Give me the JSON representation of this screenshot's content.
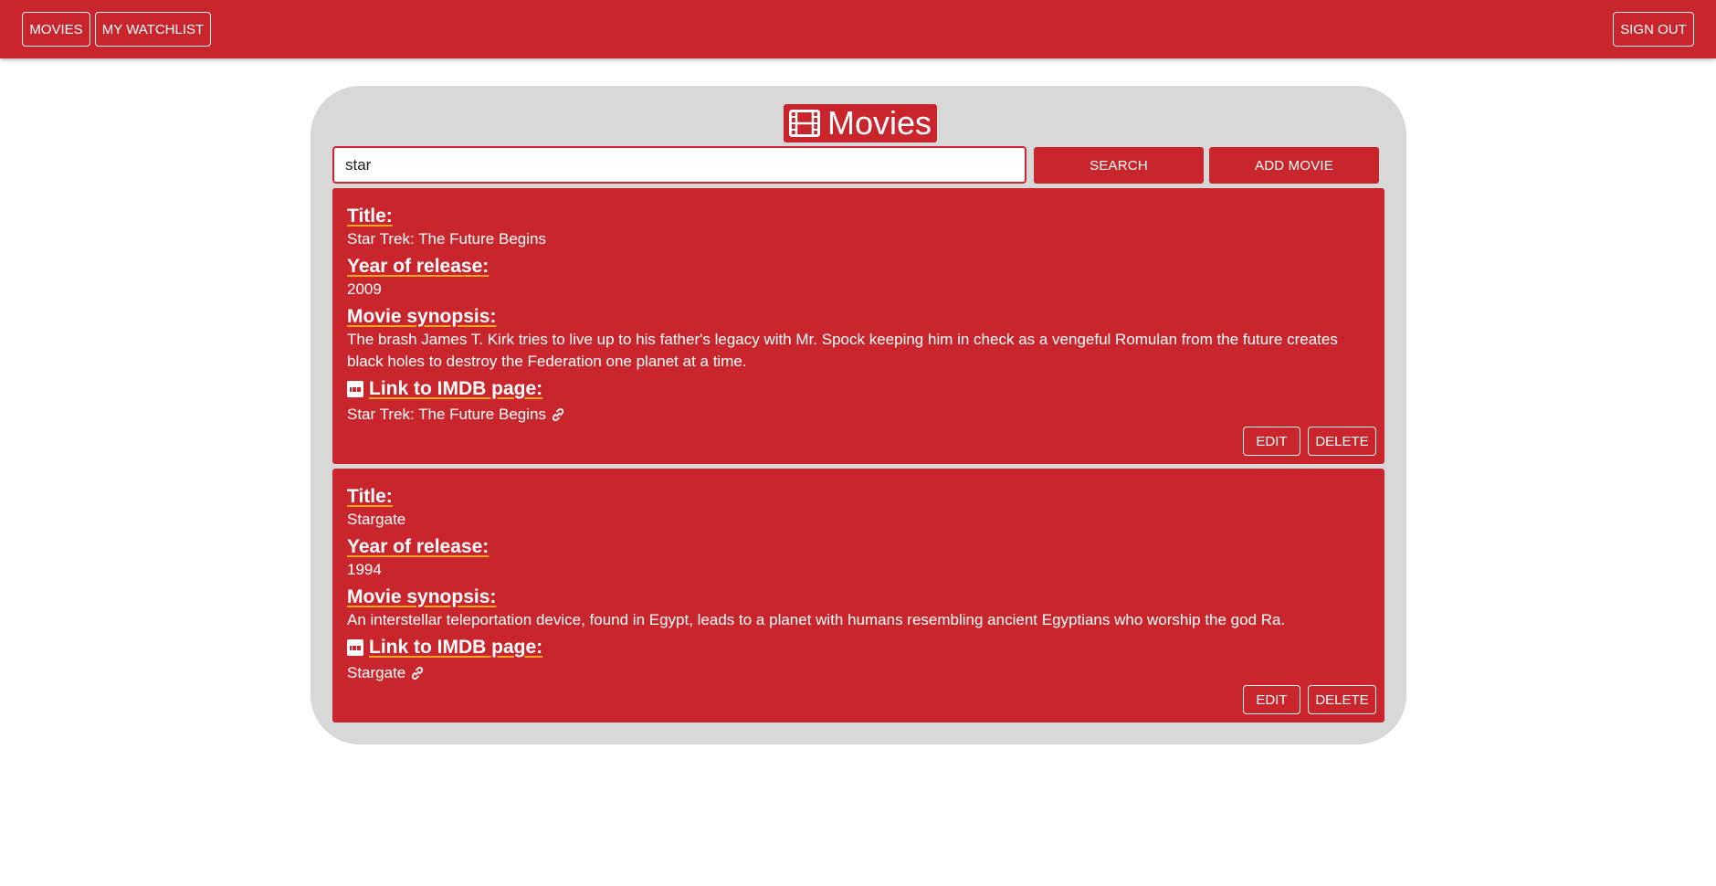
{
  "nav": {
    "movies_label": "MOVIES",
    "watchlist_label": "MY WATCHLIST",
    "signout_label": "SIGN OUT"
  },
  "page": {
    "title": "Movies",
    "title_icon": "film-icon"
  },
  "search": {
    "value": "star",
    "search_label": "SEARCH",
    "add_label": "ADD MOVIE"
  },
  "labels": {
    "title": "Title:",
    "year": "Year of release:",
    "synopsis": "Movie synopsis:",
    "imdb": "Link to IMDB page:"
  },
  "movies": [
    {
      "title": "Star Trek: The Future Begins",
      "year": "2009",
      "synopsis": "The brash James T. Kirk tries to live up to his father's legacy with Mr. Spock keeping him in check as a vengeful Romulan from the future creates black holes to destroy the Federation one planet at a time.",
      "imdb_text": "Star Trek: The Future Begins",
      "edit_label": "EDIT",
      "delete_label": "DELETE"
    },
    {
      "title": "Stargate",
      "year": "1994",
      "synopsis": "An interstellar teleportation device, found in Egypt, leads to a planet with humans resembling ancient Egyptians who worship the god Ra.",
      "imdb_text": "Stargate",
      "edit_label": "EDIT",
      "delete_label": "DELETE"
    }
  ],
  "colors": {
    "brand_red": "#c8262c",
    "panel_gray": "#d8d8d8",
    "underline_accent": "#f2a61f"
  }
}
